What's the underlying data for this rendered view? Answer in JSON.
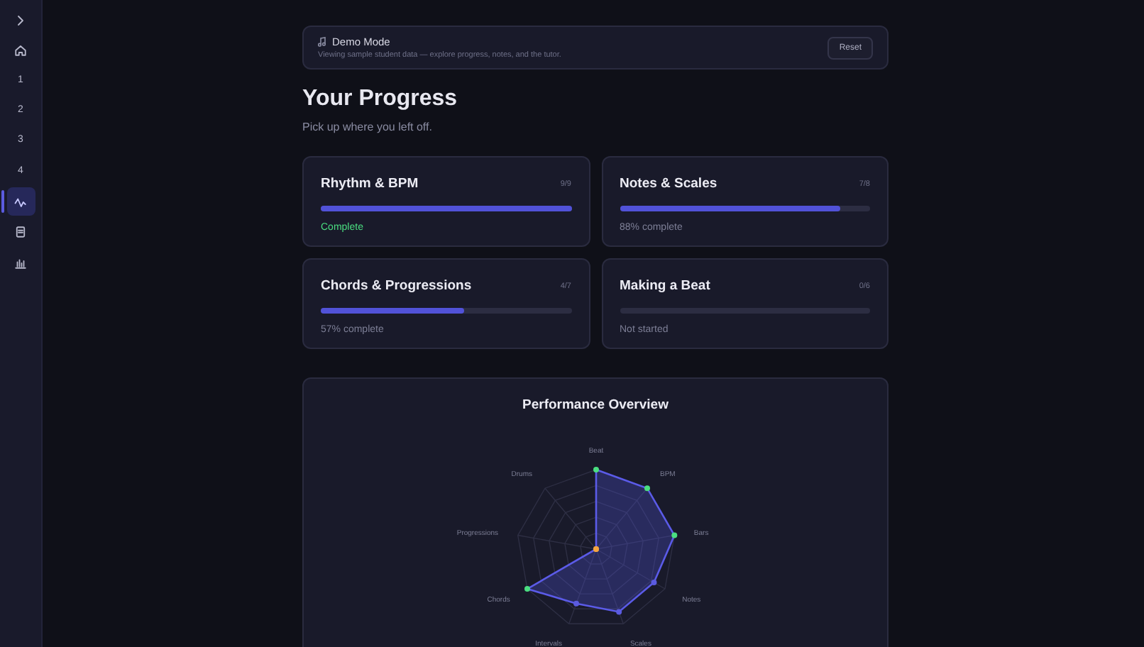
{
  "sidebar": {
    "items": [
      {
        "kind": "chevron",
        "selected": false
      },
      {
        "kind": "home",
        "selected": false
      },
      {
        "kind": "number",
        "label": "1",
        "selected": false
      },
      {
        "kind": "number",
        "label": "2",
        "selected": false
      },
      {
        "kind": "number",
        "label": "3",
        "selected": false
      },
      {
        "kind": "number",
        "label": "4",
        "selected": false
      },
      {
        "kind": "activity",
        "selected": true
      },
      {
        "kind": "document",
        "selected": false
      },
      {
        "kind": "chart",
        "selected": false
      }
    ]
  },
  "banner": {
    "title": "Demo Mode",
    "text": "Viewing sample student data — explore progress, notes, and the tutor.",
    "button": "Reset"
  },
  "heading": "Your Progress",
  "subheading": "Pick up where you left off.",
  "modules": [
    {
      "title": "Rhythm & BPM",
      "count": "9/9",
      "level": 1,
      "status": "Complete",
      "complete": true
    },
    {
      "title": "Notes & Scales",
      "count": "7/8",
      "level": 0.88,
      "status": "88% complete",
      "complete": false
    },
    {
      "title": "Chords & Progressions",
      "count": "4/7",
      "level": 0.57,
      "status": "57% complete",
      "complete": false
    },
    {
      "title": "Making a Beat",
      "count": "0/6",
      "level": 0,
      "status": "Not started",
      "complete": false
    }
  ],
  "performance": {
    "title": "Performance Overview",
    "axes": [
      {
        "label": "Beat",
        "color": "#4ade80"
      },
      {
        "label": "BPM",
        "color": "#4ade80"
      },
      {
        "label": "Bars",
        "color": "#4ade80"
      },
      {
        "label": "Notes",
        "color": "#5b5be0"
      },
      {
        "label": "Scales",
        "color": "#5b5be0"
      },
      {
        "label": "Intervals",
        "color": "#5b5be0"
      },
      {
        "label": "Chords",
        "color": "#4ade80"
      },
      {
        "label": "Progressions",
        "color": "#f5a540"
      },
      {
        "label": "Drums",
        "color": "#f5a540"
      }
    ]
  }
}
